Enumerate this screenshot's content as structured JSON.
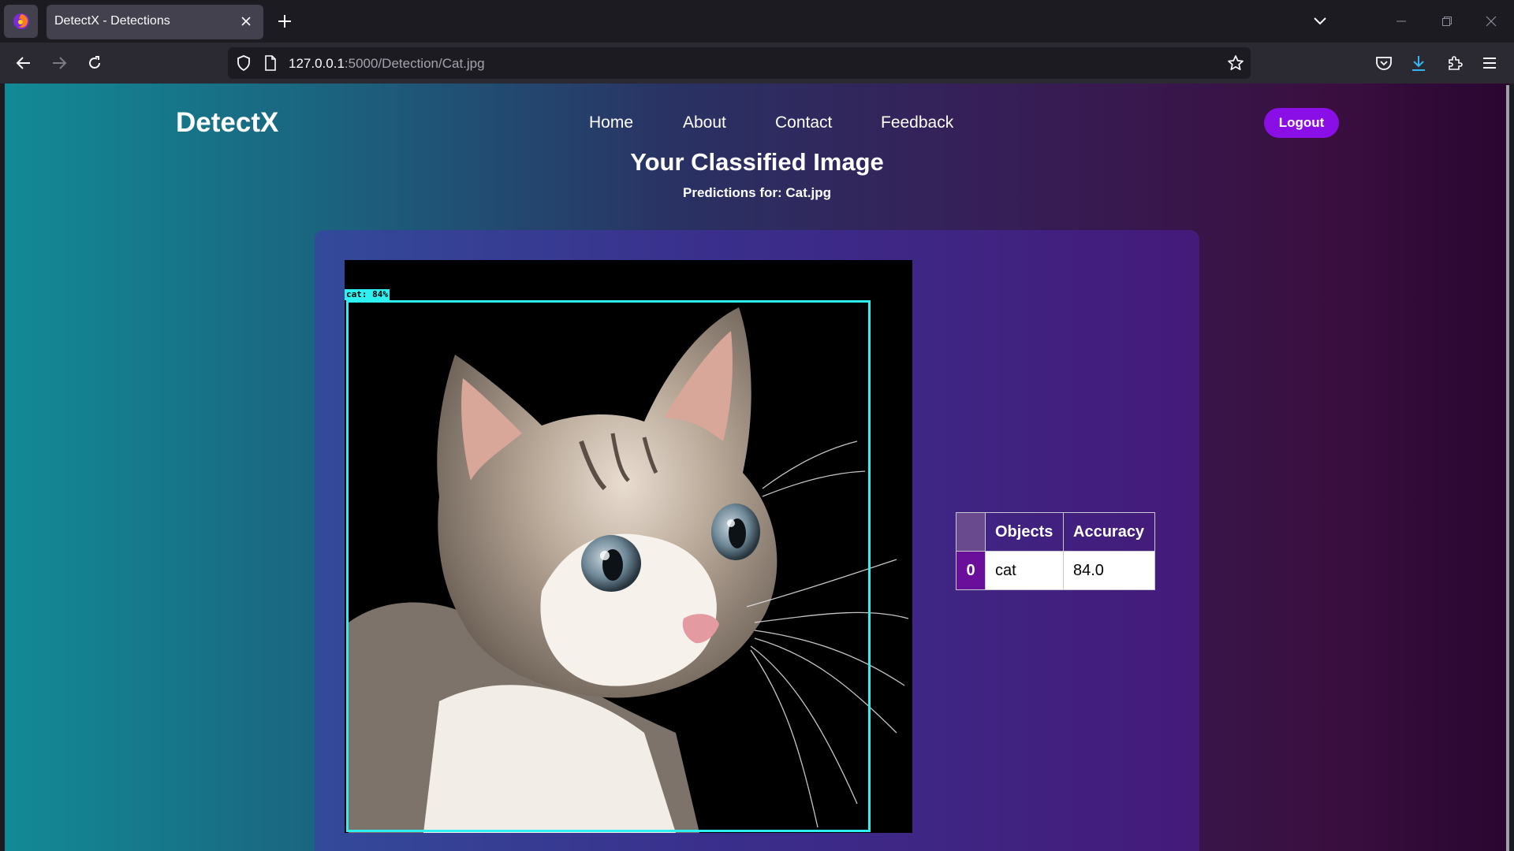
{
  "browser": {
    "tab_title": "DetectX - Detections",
    "url_host": "127.0.0.1",
    "url_rest": ":5000/Detection/Cat.jpg"
  },
  "site": {
    "brand": "DetectX",
    "nav": [
      "Home",
      "About",
      "Contact",
      "Feedback"
    ],
    "logout": "Logout"
  },
  "main": {
    "title": "Your Classified Image",
    "subtitle": "Predictions for: Cat.jpg",
    "detection_label": "cat: 84%"
  },
  "results": {
    "headers": [
      "",
      "Objects",
      "Accuracy"
    ],
    "rows": [
      {
        "index": "0",
        "object": "cat",
        "accuracy": "84.0"
      }
    ]
  },
  "colors": {
    "accent": "#8a0fe6",
    "box": "#2ff0f0"
  }
}
